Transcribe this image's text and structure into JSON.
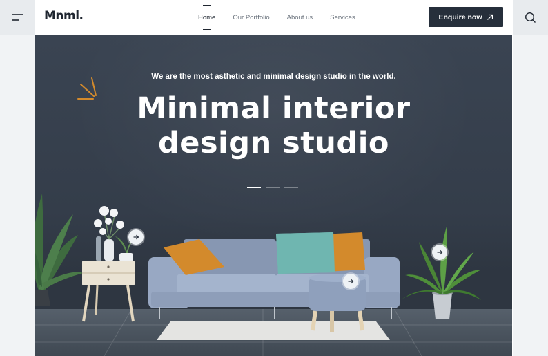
{
  "header": {
    "logo": "Mnml.",
    "nav": [
      "Home",
      "Our Portfolio",
      "About us",
      "Services"
    ],
    "active_nav": "Home",
    "cta_label": "Enquire now"
  },
  "hero": {
    "tagline": "We are the most asthetic and minimal design studio in the world.",
    "headline_line1": "Minimal interior",
    "headline_line2": "design studio",
    "slides_total": 3,
    "slide_active": 1
  },
  "colors": {
    "brand_dark": "#262f3b",
    "wall": "#3a4452",
    "sofa": "#8fa4c2",
    "accent_orange": "#d38a2c",
    "accent_teal": "#6fb6b0"
  },
  "icons": [
    "menu-icon",
    "arrow-up-right-icon",
    "search-icon",
    "arrow-right-icon"
  ]
}
